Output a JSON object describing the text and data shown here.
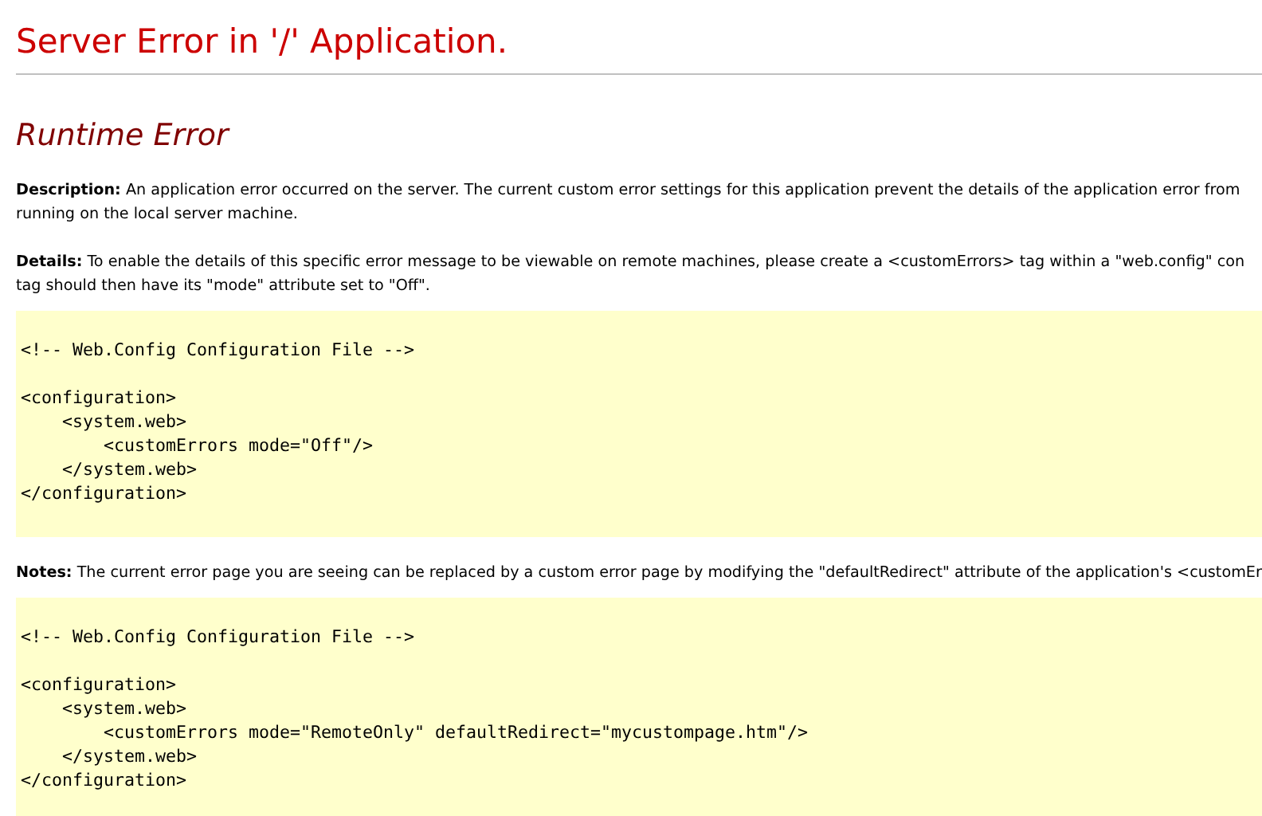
{
  "page_title": "Server Error in '/' Application.",
  "error_heading": "Runtime Error",
  "sections": [
    {
      "kind": "text",
      "lines": [
        "**Description:** An application error occurred on the server. The current custom error settings for this application prevent the details of the application error from",
        "running on the local server machine."
      ]
    },
    {
      "kind": "text",
      "lines": [
        "**Details:** To enable the details of this specific error message to be viewable on remote machines, please create a <customErrors> tag within a \"web.config\" con",
        "tag should then have its \"mode\" attribute set to \"Off\"."
      ]
    },
    {
      "kind": "code",
      "comment": "<!-- Web.Config Configuration File -->",
      "lines": [
        "<configuration>",
        "    <system.web>",
        "        <customErrors mode=\"Off\"/>",
        "    </system.web>",
        "</configuration>"
      ]
    },
    {
      "kind": "text",
      "lines": [
        "**Notes:** The current error page you are seeing can be replaced by a custom error page by modifying the \"defaultRedirect\" attribute of the application's <customEr"
      ]
    },
    {
      "kind": "code",
      "comment": "<!-- Web.Config Configuration File -->",
      "lines": [
        "<configuration>",
        "    <system.web>",
        "        <customErrors mode=\"RemoteOnly\" defaultRedirect=\"mycustompage.htm\"/>",
        "    </system.web>",
        "</configuration>"
      ]
    }
  ]
}
